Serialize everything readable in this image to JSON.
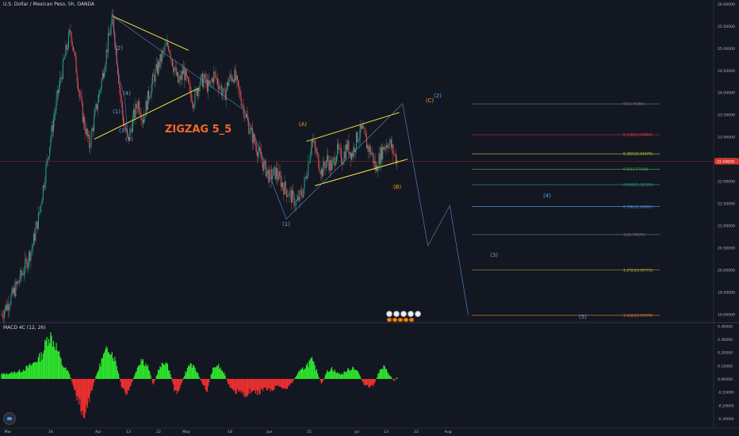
{
  "header": {
    "symbol_title": "U.S. Dollar / Mexican Peso, 5h, OANDA",
    "macd_label": "MACD 4C (12, 26)"
  },
  "colors": {
    "background": "#131722",
    "candle_up": "#26a69a",
    "candle_down": "#ef5350",
    "trendline": "#f0ea3c",
    "wave_path": "#5b8fc9",
    "wave_label_blue": "#5aa6e6",
    "wave_label_orange": "#f79b1e",
    "zigzag_text": "#f4682a",
    "price_line": "#d8342b",
    "macd_green": "#2ee82e",
    "macd_red": "#f23030"
  },
  "chart_data": [
    {
      "type": "candlestick",
      "title": "U.S. Dollar / Mexican Peso, 5h, OANDA",
      "x_ticks": [
        "Mar",
        "16",
        "Apr",
        "13",
        "22",
        "May",
        "18",
        "Jun",
        "15",
        "Jul",
        "13",
        "22",
        "Aug"
      ],
      "y_ticks": [
        "26.00000",
        "25.50000",
        "25.00000",
        "24.50000",
        "24.00000",
        "23.50000",
        "23.00000",
        "22.50000",
        "22.00000",
        "21.50000",
        "21.00000",
        "20.50000",
        "20.00000",
        "19.50000",
        "19.00000"
      ],
      "ylim": [
        18.85,
        26.05
      ],
      "current_price": "22.44959",
      "current_price_value": 22.44959,
      "close_path": [
        [
          0,
          19.0
        ],
        [
          0.3,
          19.4
        ],
        [
          0.6,
          19.9
        ],
        [
          0.9,
          20.5
        ],
        [
          1.1,
          21.2
        ],
        [
          1.3,
          22.2
        ],
        [
          1.5,
          23.2
        ],
        [
          1.7,
          24.1
        ],
        [
          1.9,
          24.9
        ],
        [
          2.05,
          25.4
        ],
        [
          2.2,
          24.6
        ],
        [
          2.4,
          23.5
        ],
        [
          2.6,
          22.8
        ],
        [
          2.8,
          23.6
        ],
        [
          3.0,
          24.4
        ],
        [
          3.15,
          25.1
        ],
        [
          3.3,
          25.7
        ],
        [
          3.45,
          24.5
        ],
        [
          3.6,
          23.4
        ],
        [
          3.75,
          22.9
        ],
        [
          3.9,
          23.4
        ],
        [
          4.05,
          23.8
        ],
        [
          4.2,
          23.4
        ],
        [
          4.35,
          23.9
        ],
        [
          4.5,
          24.3
        ],
        [
          4.65,
          24.6
        ],
        [
          4.8,
          24.9
        ],
        [
          4.95,
          25.1
        ],
        [
          5.1,
          24.6
        ],
        [
          5.25,
          24.2
        ],
        [
          5.4,
          24.5
        ],
        [
          5.55,
          24.1
        ],
        [
          5.7,
          23.8
        ],
        [
          5.85,
          24.2
        ],
        [
          6.0,
          24.3
        ],
        [
          6.15,
          24.1
        ],
        [
          6.3,
          24.4
        ],
        [
          6.45,
          24.2
        ],
        [
          6.6,
          23.9
        ],
        [
          6.75,
          24.3
        ],
        [
          6.9,
          24.4
        ],
        [
          7.05,
          24.0
        ],
        [
          7.2,
          23.6
        ],
        [
          7.35,
          23.2
        ],
        [
          7.55,
          22.8
        ],
        [
          7.75,
          22.4
        ],
        [
          7.95,
          22.1
        ],
        [
          8.15,
          22.2
        ],
        [
          8.35,
          21.9
        ],
        [
          8.55,
          21.7
        ],
        [
          8.75,
          21.5
        ],
        [
          8.95,
          21.8
        ],
        [
          9.1,
          22.4
        ],
        [
          9.2,
          22.95
        ],
        [
          9.35,
          22.6
        ],
        [
          9.5,
          22.2
        ],
        [
          9.65,
          22.5
        ],
        [
          9.8,
          22.3
        ],
        [
          9.95,
          22.7
        ],
        [
          10.1,
          22.5
        ],
        [
          10.25,
          22.8
        ],
        [
          10.4,
          22.6
        ],
        [
          10.55,
          23.0
        ],
        [
          10.7,
          23.15
        ],
        [
          10.85,
          22.8
        ],
        [
          11.0,
          22.6
        ],
        [
          11.1,
          22.25
        ],
        [
          11.2,
          22.5
        ],
        [
          11.35,
          22.8
        ],
        [
          11.5,
          22.9
        ],
        [
          11.6,
          22.7
        ],
        [
          11.75,
          22.44959
        ]
      ],
      "annotations": {
        "zigzag_title": "ZIGZAG 5_5",
        "wave_labels_blue": [
          "(2)",
          "(4)",
          "(1)",
          "(3)",
          "(5)",
          "(1)",
          "(2)",
          "(3)",
          "(4)",
          "(5)"
        ],
        "wave_labels_orange": [
          "(A)",
          "(B)",
          "(C)"
        ]
      },
      "fibonacci_levels": [
        {
          "label": "0(23.74365)",
          "value": 23.74365,
          "color": "#787b86"
        },
        {
          "label": "0.236(23.04865)",
          "value": 23.04865,
          "color": "#f23645"
        },
        {
          "label": "0.382(22.61879)",
          "value": 22.61879,
          "color": "#b7d13a"
        },
        {
          "label": "0.5(22.27108)",
          "value": 22.27108,
          "color": "#4caf50"
        },
        {
          "label": "0.618(21.92320)",
          "value": 21.9232,
          "color": "#26a69a"
        },
        {
          "label": "0.786(21.42891)",
          "value": 21.42891,
          "color": "#5b9cf6"
        },
        {
          "label": "1(20.79874)",
          "value": 20.79874,
          "color": "#787b86"
        },
        {
          "label": "1.272(19.99773)",
          "value": 19.99773,
          "color": "#c2c03a"
        },
        {
          "label": "1.618(18.97879)",
          "value": 18.97879,
          "color": "#e4852f"
        }
      ],
      "wave_forecast": [
        [
          11.9,
          23.75
        ],
        [
          12.65,
          20.55
        ],
        [
          13.3,
          21.45
        ],
        [
          13.85,
          18.98
        ]
      ],
      "trendlines": [
        [
          [
            3.3,
            25.72
          ],
          [
            5.55,
            24.95
          ]
        ],
        [
          [
            2.75,
            22.95
          ],
          [
            5.85,
            24.1
          ]
        ],
        [
          [
            9.05,
            22.9
          ],
          [
            11.8,
            23.55
          ]
        ],
        [
          [
            9.3,
            21.9
          ],
          [
            12.05,
            22.5
          ]
        ]
      ]
    },
    {
      "type": "bar",
      "title": "MACD 4C (12, 26)",
      "y_ticks": [
        "0.40000",
        "0.30000",
        "0.20000",
        "0.10000",
        "0.00000",
        "-0.10000",
        "-0.20000",
        "-0.30000"
      ],
      "ylim": [
        -0.36,
        0.42
      ],
      "positive_color": "#2ee82e",
      "negative_color": "#f23030",
      "histogram_envelope": [
        [
          0,
          0.04
        ],
        [
          0.3,
          0.05
        ],
        [
          0.6,
          0.07
        ],
        [
          0.9,
          0.12
        ],
        [
          1.2,
          0.2
        ],
        [
          1.4,
          0.38
        ],
        [
          1.6,
          0.29
        ],
        [
          1.8,
          0.12
        ],
        [
          2.0,
          0.05
        ],
        [
          2.15,
          -0.08
        ],
        [
          2.3,
          -0.2
        ],
        [
          2.45,
          -0.3
        ],
        [
          2.6,
          -0.18
        ],
        [
          2.8,
          0.02
        ],
        [
          3.0,
          0.18
        ],
        [
          3.2,
          0.27
        ],
        [
          3.4,
          0.14
        ],
        [
          3.55,
          -0.06
        ],
        [
          3.7,
          -0.14
        ],
        [
          3.85,
          -0.05
        ],
        [
          4.0,
          0.08
        ],
        [
          4.15,
          0.17
        ],
        [
          4.35,
          0.1
        ],
        [
          4.5,
          -0.05
        ],
        [
          4.65,
          0.07
        ],
        [
          4.85,
          0.15
        ],
        [
          5.0,
          0.06
        ],
        [
          5.15,
          -0.12
        ],
        [
          5.3,
          -0.08
        ],
        [
          5.45,
          0.05
        ],
        [
          5.6,
          0.13
        ],
        [
          5.8,
          0.06
        ],
        [
          5.95,
          -0.04
        ],
        [
          6.1,
          -0.1
        ],
        [
          6.25,
          0.07
        ],
        [
          6.4,
          0.12
        ],
        [
          6.6,
          0.05
        ],
        [
          6.75,
          -0.06
        ],
        [
          6.9,
          -0.12
        ],
        [
          7.05,
          -0.1
        ],
        [
          7.2,
          -0.14
        ],
        [
          7.4,
          -0.1
        ],
        [
          7.6,
          -0.12
        ],
        [
          7.8,
          -0.08
        ],
        [
          8.0,
          -0.1
        ],
        [
          8.2,
          -0.05
        ],
        [
          8.4,
          -0.09
        ],
        [
          8.6,
          -0.04
        ],
        [
          8.8,
          0.05
        ],
        [
          9.0,
          0.1
        ],
        [
          9.2,
          0.16
        ],
        [
          9.35,
          0.07
        ],
        [
          9.5,
          -0.05
        ],
        [
          9.65,
          0.06
        ],
        [
          9.8,
          0.09
        ],
        [
          9.95,
          0.05
        ],
        [
          10.1,
          0.04
        ],
        [
          10.25,
          0.07
        ],
        [
          10.45,
          0.1
        ],
        [
          10.6,
          0.05
        ],
        [
          10.75,
          -0.05
        ],
        [
          10.9,
          -0.07
        ],
        [
          11.05,
          -0.05
        ],
        [
          11.2,
          0.06
        ],
        [
          11.35,
          0.1
        ],
        [
          11.5,
          0.04
        ],
        [
          11.65,
          -0.02
        ],
        [
          11.75,
          0.02
        ]
      ]
    }
  ]
}
